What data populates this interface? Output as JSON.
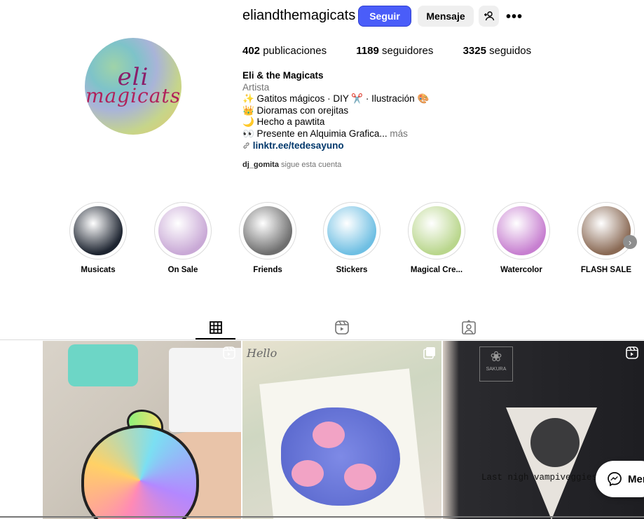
{
  "profile": {
    "username": "eliandthemagicats",
    "avatar_text_1": "eli",
    "avatar_text_2": "magicats",
    "follow_label": "Seguir",
    "message_label": "Mensaje",
    "more_icon": "•••"
  },
  "stats": {
    "posts_count": "402",
    "posts_label": "publicaciones",
    "followers_count": "1189",
    "followers_label": "seguidores",
    "following_count": "3325",
    "following_label": "seguidos"
  },
  "bio": {
    "name": "Eli & the Magicats",
    "category": "Artista",
    "line1": "✨ Gatitos mágicos · DIY ✂️ · Ilustración 🎨",
    "line2": "👑 Dioramas con orejitas",
    "line3": "🌙 Hecho a pawtita",
    "line4": "👀 Presente en Alquimia Grafica...",
    "more": "más",
    "link": "linktr.ee/tedesayuno"
  },
  "followed_by": {
    "user": "dj_gomita",
    "text": "sigue esta cuenta"
  },
  "highlights": [
    {
      "label": "Musicats",
      "color": "#1d2430"
    },
    {
      "label": "On Sale",
      "color": "#c9a9d6"
    },
    {
      "label": "Friends",
      "color": "#6f6f6f"
    },
    {
      "label": "Stickers",
      "color": "#6fbfe3"
    },
    {
      "label": "Magical Cre...",
      "color": "#b9d68c"
    },
    {
      "label": "Watercolor",
      "color": "#c77fd0"
    },
    {
      "label": "FLASH SALE",
      "color": "#8a6a55"
    }
  ],
  "tabs": [
    {
      "name": "posts",
      "icon": "grid-icon"
    },
    {
      "name": "reels",
      "icon": "reels-icon"
    },
    {
      "name": "tagged",
      "icon": "tagged-icon"
    }
  ],
  "posts": [
    {
      "kind": "reel",
      "caption": ""
    },
    {
      "kind": "carousel",
      "caption": "Hello"
    },
    {
      "kind": "reel",
      "caption": "Last nigh vampiveggies",
      "brand": "SAKURA"
    }
  ],
  "messenger": {
    "label": "Mer"
  }
}
